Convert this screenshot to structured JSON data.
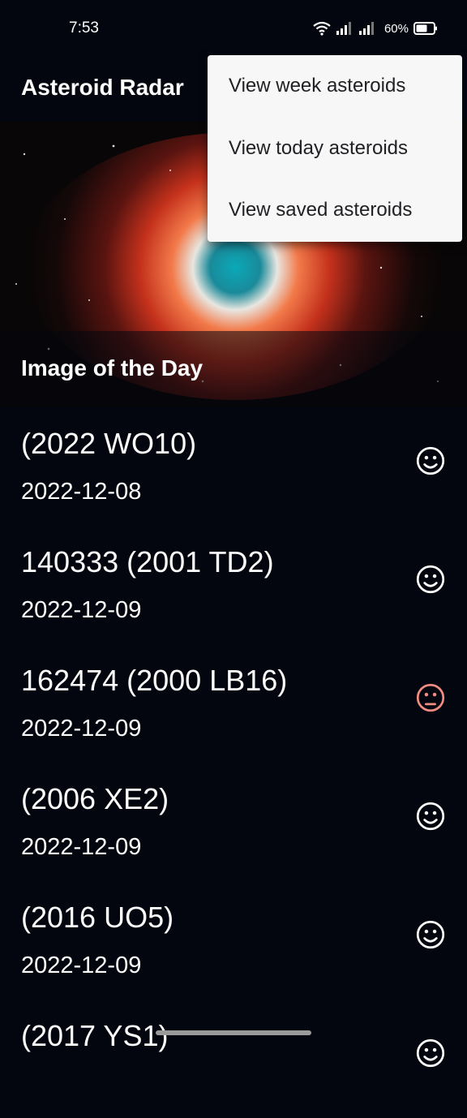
{
  "status_bar": {
    "time": "7:53",
    "battery": "60%"
  },
  "app_bar": {
    "title": "Asteroid Radar"
  },
  "image_of_day": {
    "caption": "Image of the Day"
  },
  "menu": {
    "items": [
      {
        "label": "View week asteroids"
      },
      {
        "label": "View today asteroids"
      },
      {
        "label": "View saved asteroids"
      }
    ]
  },
  "asteroids": [
    {
      "name": "(2022 WO10)",
      "date": "2022-12-08",
      "status": "safe",
      "color": "#ffffff"
    },
    {
      "name": "140333 (2001 TD2)",
      "date": "2022-12-09",
      "status": "safe",
      "color": "#ffffff"
    },
    {
      "name": "162474 (2000 LB16)",
      "date": "2022-12-09",
      "status": "hazardous",
      "color": "#f28b82"
    },
    {
      "name": "(2006 XE2)",
      "date": "2022-12-09",
      "status": "safe",
      "color": "#ffffff"
    },
    {
      "name": "(2016 UO5)",
      "date": "2022-12-09",
      "status": "safe",
      "color": "#ffffff"
    },
    {
      "name": "(2017 YS1)",
      "date": "",
      "status": "safe",
      "color": "#ffffff"
    }
  ]
}
